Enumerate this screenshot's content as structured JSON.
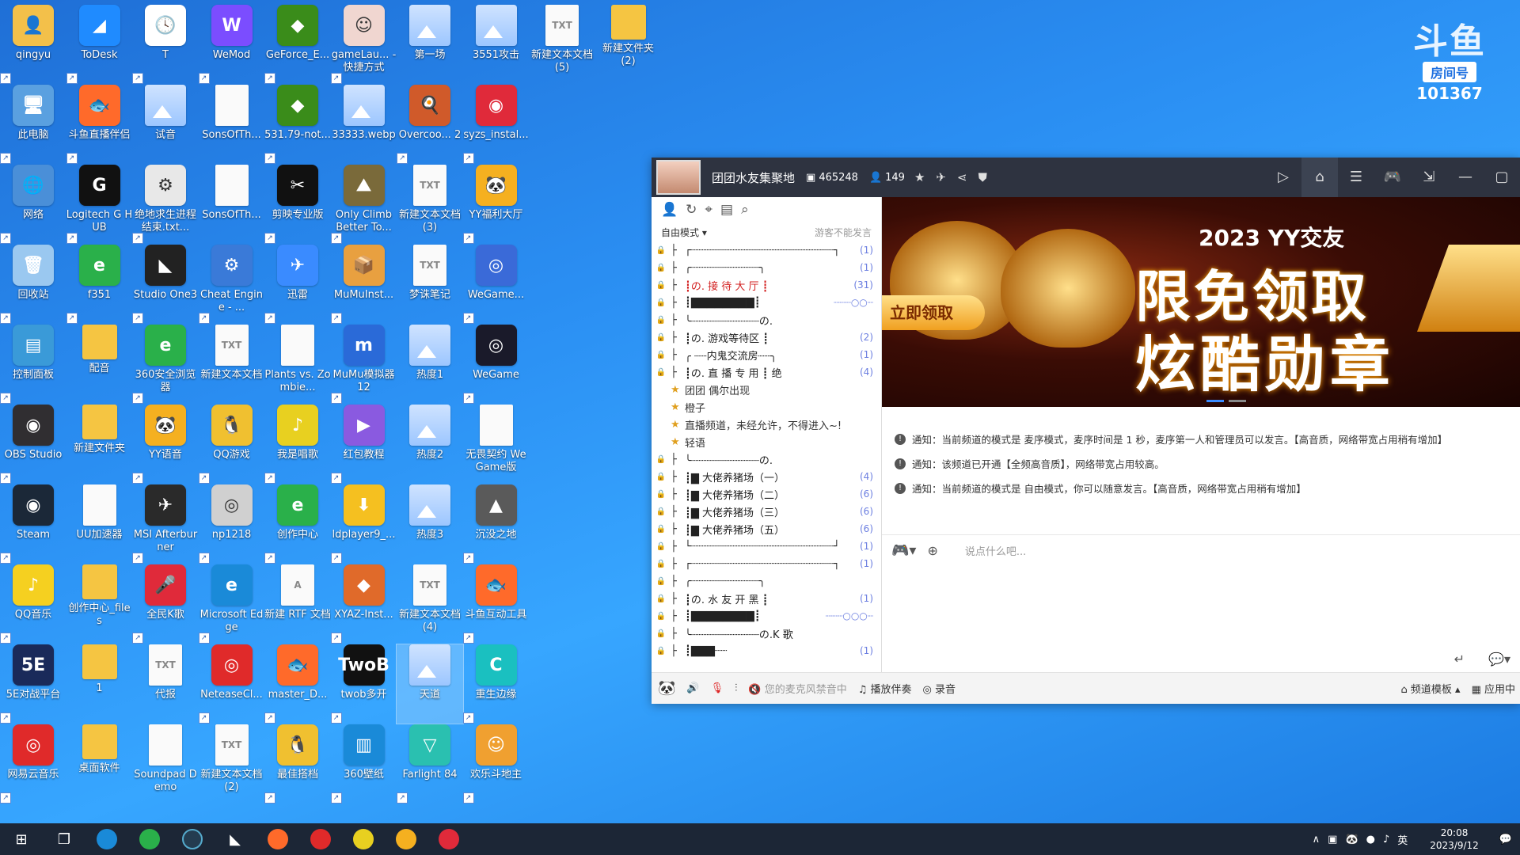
{
  "desktop_icons": [
    {
      "label": "qingyu",
      "glyph": "👤",
      "color": "#f3c04a",
      "kind": "app"
    },
    {
      "label": "ToDesk",
      "glyph": "◢",
      "color": "#1f8bff",
      "kind": "app"
    },
    {
      "label": "T",
      "glyph": "🕓",
      "color": "#ffffff",
      "kind": "app"
    },
    {
      "label": "WeMod",
      "glyph": "W",
      "color": "#7b4dff",
      "kind": "app"
    },
    {
      "label": "GeForce_E...",
      "glyph": "◆",
      "color": "#3a8c1a",
      "kind": "app"
    },
    {
      "label": "gameLau... - 快捷方式",
      "glyph": "☺",
      "color": "#f0d6d0",
      "kind": "app"
    },
    {
      "label": "第一场",
      "glyph": "",
      "color": "",
      "kind": "img"
    },
    {
      "label": "3551攻击",
      "glyph": "",
      "color": "",
      "kind": "img"
    },
    {
      "label": "新建文本文档 (5)",
      "glyph": "TXT",
      "color": "",
      "kind": "file"
    },
    {
      "label": "新建文件夹 (2)",
      "glyph": "",
      "color": "",
      "kind": "folder"
    },
    {
      "label": "此电脑",
      "glyph": "🖥",
      "color": "#5aa0e0",
      "kind": "app"
    },
    {
      "label": "斗鱼直播伴侣",
      "glyph": "🐟",
      "color": "#ff6a2a",
      "kind": "app"
    },
    {
      "label": "试音",
      "glyph": "",
      "color": "",
      "kind": "img"
    },
    {
      "label": "SonsOfTh...",
      "glyph": "",
      "color": "",
      "kind": "file"
    },
    {
      "label": "531.79-not...",
      "glyph": "◆",
      "color": "#3a8c1a",
      "kind": "app"
    },
    {
      "label": "33333.webp",
      "glyph": "",
      "color": "",
      "kind": "img"
    },
    {
      "label": "Overcoo... 2",
      "glyph": "🍳",
      "color": "#d05a2a",
      "kind": "app"
    },
    {
      "label": "syzs_instal...",
      "glyph": "◉",
      "color": "#e02a3a",
      "kind": "app"
    },
    {
      "label": "网络",
      "glyph": "🌐",
      "color": "#4a8fd8",
      "kind": "app"
    },
    {
      "label": "Logitech G HUB",
      "glyph": "G",
      "color": "#111111",
      "kind": "app"
    },
    {
      "label": "绝地求生进程结束.txt...",
      "glyph": "⚙",
      "color": "#e8e8e8",
      "kind": "app"
    },
    {
      "label": "SonsOfTh...",
      "glyph": "",
      "color": "",
      "kind": "file"
    },
    {
      "label": "剪映专业版",
      "glyph": "✂",
      "color": "#111111",
      "kind": "app"
    },
    {
      "label": "Only Climb Better To...",
      "glyph": "⛰",
      "color": "#7a6a3a",
      "kind": "app"
    },
    {
      "label": "新建文本文档 (3)",
      "glyph": "TXT",
      "color": "",
      "kind": "file"
    },
    {
      "label": "YY福利大厅",
      "glyph": "🐼",
      "color": "#f5b020",
      "kind": "app"
    },
    {
      "label": "回收站",
      "glyph": "🗑",
      "color": "#9ac8f0",
      "kind": "app"
    },
    {
      "label": "f351",
      "glyph": "e",
      "color": "#2ab04a",
      "kind": "app"
    },
    {
      "label": "Studio One3",
      "glyph": "◣",
      "color": "#222222",
      "kind": "app"
    },
    {
      "label": "Cheat Engine - ...",
      "glyph": "⚙",
      "color": "#3a7ad8",
      "kind": "app"
    },
    {
      "label": "迅雷",
      "glyph": "✈",
      "color": "#3a8bff",
      "kind": "app"
    },
    {
      "label": "MuMuInst...",
      "glyph": "📦",
      "color": "#e8a040",
      "kind": "app"
    },
    {
      "label": "梦诛笔记",
      "glyph": "TXT",
      "color": "",
      "kind": "file"
    },
    {
      "label": "WeGame...",
      "glyph": "◎",
      "color": "#3a6ad8",
      "kind": "app"
    },
    {
      "label": "控制面板",
      "glyph": "▤",
      "color": "#3a9ad8",
      "kind": "app"
    },
    {
      "label": "配音",
      "glyph": "",
      "color": "",
      "kind": "folder"
    },
    {
      "label": "360安全浏览器",
      "glyph": "e",
      "color": "#2ab04a",
      "kind": "app"
    },
    {
      "label": "新建文本文档",
      "glyph": "TXT",
      "color": "",
      "kind": "file"
    },
    {
      "label": "Plants vs. Zombie...",
      "glyph": "",
      "color": "",
      "kind": "file"
    },
    {
      "label": "MuMu模拟器12",
      "glyph": "m",
      "color": "#2a6ad8",
      "kind": "app"
    },
    {
      "label": "热度1",
      "glyph": "",
      "color": "",
      "kind": "img"
    },
    {
      "label": "WeGame",
      "glyph": "◎",
      "color": "#1a1a2a",
      "kind": "app"
    },
    {
      "label": "OBS Studio",
      "glyph": "◉",
      "color": "#302e31",
      "kind": "app"
    },
    {
      "label": "新建文件夹",
      "glyph": "",
      "color": "",
      "kind": "folder"
    },
    {
      "label": "YY语音",
      "glyph": "🐼",
      "color": "#f5b020",
      "kind": "app"
    },
    {
      "label": "QQ游戏",
      "glyph": "🐧",
      "color": "#f0c030",
      "kind": "app"
    },
    {
      "label": "我是唱歌",
      "glyph": "♪",
      "color": "#e8d020",
      "kind": "app"
    },
    {
      "label": "红包教程",
      "glyph": "▶",
      "color": "#8a5ae0",
      "kind": "app"
    },
    {
      "label": "热度2",
      "glyph": "",
      "color": "",
      "kind": "img"
    },
    {
      "label": "无畏契约 WeGame版",
      "glyph": "",
      "color": "",
      "kind": "file"
    },
    {
      "label": "Steam",
      "glyph": "◉",
      "color": "#1b2838",
      "kind": "app"
    },
    {
      "label": "UU加速器",
      "glyph": "",
      "color": "",
      "kind": "file"
    },
    {
      "label": "MSI Afterburner",
      "glyph": "✈",
      "color": "#2a2a2a",
      "kind": "app"
    },
    {
      "label": "np1218",
      "glyph": "◎",
      "color": "#d0d0d0",
      "kind": "app"
    },
    {
      "label": "创作中心",
      "glyph": "e",
      "color": "#2ab04a",
      "kind": "app"
    },
    {
      "label": "ldplayer9_...",
      "glyph": "⬇",
      "color": "#f5c020",
      "kind": "app"
    },
    {
      "label": "热度3",
      "glyph": "",
      "color": "",
      "kind": "img"
    },
    {
      "label": "沉没之地",
      "glyph": "▲",
      "color": "#5a5a5a",
      "kind": "app"
    },
    {
      "label": "QQ音乐",
      "glyph": "♪",
      "color": "#f5d020",
      "kind": "app"
    },
    {
      "label": "创作中心_files",
      "glyph": "",
      "color": "",
      "kind": "folder"
    },
    {
      "label": "全民K歌",
      "glyph": "🎤",
      "color": "#e02a3a",
      "kind": "app"
    },
    {
      "label": "Microsoft Edge",
      "glyph": "e",
      "color": "#1a8ad8",
      "kind": "app"
    },
    {
      "label": "新建 RTF 文档",
      "glyph": "A",
      "color": "",
      "kind": "file"
    },
    {
      "label": "XYAZ-Inst...",
      "glyph": "◆",
      "color": "#e06a2a",
      "kind": "app"
    },
    {
      "label": "新建文本文档 (4)",
      "glyph": "TXT",
      "color": "",
      "kind": "file"
    },
    {
      "label": "斗鱼互动工具",
      "glyph": "🐟",
      "color": "#ff6a2a",
      "kind": "app"
    },
    {
      "label": "5E对战平台",
      "glyph": "5E",
      "color": "#1a2a5a",
      "kind": "app"
    },
    {
      "label": "1",
      "glyph": "",
      "color": "",
      "kind": "folder"
    },
    {
      "label": "代报",
      "glyph": "TXT",
      "color": "",
      "kind": "file"
    },
    {
      "label": "NeteaseCl...",
      "glyph": "◎",
      "color": "#e02a2a",
      "kind": "app"
    },
    {
      "label": "master_D...",
      "glyph": "🐟",
      "color": "#ff6a2a",
      "kind": "app"
    },
    {
      "label": "twob多开",
      "glyph": "TwoB",
      "color": "#111111",
      "kind": "app"
    },
    {
      "label": "天道",
      "glyph": "",
      "color": "",
      "kind": "img",
      "selected": true
    },
    {
      "label": "重生边缘",
      "glyph": "C",
      "color": "#1ac0c0",
      "kind": "app"
    },
    {
      "label": "网易云音乐",
      "glyph": "◎",
      "color": "#e02a2a",
      "kind": "app"
    },
    {
      "label": "桌面软件",
      "glyph": "",
      "color": "",
      "kind": "folder"
    },
    {
      "label": "Soundpad Demo",
      "glyph": "",
      "color": "",
      "kind": "file"
    },
    {
      "label": "新建文本文档 (2)",
      "glyph": "TXT",
      "color": "",
      "kind": "file"
    },
    {
      "label": "最佳搭档",
      "glyph": "🐧",
      "color": "#f0c030",
      "kind": "app"
    },
    {
      "label": "360壁纸",
      "glyph": "▥",
      "color": "#1a8ad8",
      "kind": "app"
    },
    {
      "label": "Farlight 84",
      "glyph": "▽",
      "color": "#2ac0b0",
      "kind": "app"
    },
    {
      "label": "欢乐斗地主",
      "glyph": "☺",
      "color": "#f0a030",
      "kind": "app"
    }
  ],
  "douyu_logo": {
    "mark": "斗鱼",
    "tag": "房间号",
    "room": "101367"
  },
  "yy": {
    "channel_name": "团团水友集聚地",
    "channel_id": "465248",
    "online": "149",
    "mode": "自由模式",
    "guest_notice": "游客不能发言",
    "tree": [
      {
        "name": "┌┈┈┈┈┈┈┈┈┈┈┈┈┈┈┈┈┈┈┈┈┈┈┈┐",
        "cnt": "(1)",
        "style": ""
      },
      {
        "name": "╭┈┈┈┈┈┈┈┈┈┈┈╮",
        "cnt": "(1)",
        "style": ""
      },
      {
        "name": "┋の. 接 待 大 厅 ┋",
        "cnt": "(31)",
        "style": "red"
      },
      {
        "name": "┋▇▇▇▇▇▇▇▇┋",
        "cnt": "┈┈┈○○┈",
        "style": ""
      },
      {
        "name": "╰┈┈┈┈┈┈┈┈┈┈┈の.",
        "cnt": "",
        "style": ""
      },
      {
        "name": "┋の. 游戏等待区 ┋",
        "cnt": "(2)",
        "style": ""
      },
      {
        "name": "╭ ┈┈内鬼交流房┈┈╮",
        "cnt": "(1)",
        "style": ""
      },
      {
        "name": "┋の. 直 播 专 用 ┋ 绝",
        "cnt": "(4)",
        "style": ""
      },
      {
        "name": "团团 偶尔出现",
        "cnt": "",
        "style": "user"
      },
      {
        "name": "橙子",
        "cnt": "",
        "style": "user"
      },
      {
        "name": "直播频道，未经允许，不得进入~!",
        "cnt": "",
        "style": "user"
      },
      {
        "name": "轻语",
        "cnt": "",
        "style": "user"
      },
      {
        "name": "╰┈┈┈┈┈┈┈┈┈┈┈の.",
        "cnt": "",
        "style": ""
      },
      {
        "name": "   ┋▇ 大佬养猪场（一）",
        "cnt": "(4)",
        "style": ""
      },
      {
        "name": "   ┋▇ 大佬养猪场（二）",
        "cnt": "(6)",
        "style": ""
      },
      {
        "name": "   ┋▇ 大佬养猪场（三）",
        "cnt": "(6)",
        "style": ""
      },
      {
        "name": "   ┋▇ 大佬养猪场（五）",
        "cnt": "(6)",
        "style": ""
      },
      {
        "name": "└┈┈┈┈┈┈┈┈┈┈┈┈┈┈┈┈┈┈┈┈┈┈┈┘",
        "cnt": "(1)",
        "style": ""
      },
      {
        "name": "┌┈┈┈┈┈┈┈┈┈┈┈┈┈┈┈┈┈┈┈┈┈┈┈┐",
        "cnt": "(1)",
        "style": ""
      },
      {
        "name": "╭┈┈┈┈┈┈┈┈┈┈┈╮",
        "cnt": "",
        "style": ""
      },
      {
        "name": "┋の. 水 友 开 黑 ┋",
        "cnt": "(1)",
        "style": ""
      },
      {
        "name": "┋▇▇▇▇▇▇▇▇┋",
        "cnt": "┈┈┈○○○┈",
        "style": ""
      },
      {
        "name": "╰┈┈┈┈┈┈┈┈┈┈┈の.K 歌",
        "cnt": "",
        "style": ""
      },
      {
        "name": "                ┋▇▇▇┈┈",
        "cnt": "(1)",
        "style": ""
      }
    ],
    "banner": {
      "t1": "2023 YY交友",
      "t2": "限免领取",
      "t3": "炫酷勋章",
      "claim": "立即领取"
    },
    "messages": [
      "通知：当前频道的模式是 麦序模式，麦序时间是 1 秒，麦序第一人和管理员可以发言。【高音质，网络带宽占用稍有增加】",
      "通知：该频道已开通【全频高音质】，网络带宽占用较高。",
      "通知：当前频道的模式是 自由模式，你可以随意发言。【高音质，网络带宽占用稍有增加】"
    ],
    "input_placeholder": "说点什么吧...",
    "bottom": {
      "mic_muted": "您的麦克风禁音中",
      "accompany": "播放伴奏",
      "record": "录音",
      "template": "频道模板",
      "app_center": "应用中"
    }
  },
  "taskbar": {
    "ime": "英",
    "time": "20:08",
    "date": "2023/9/12"
  }
}
